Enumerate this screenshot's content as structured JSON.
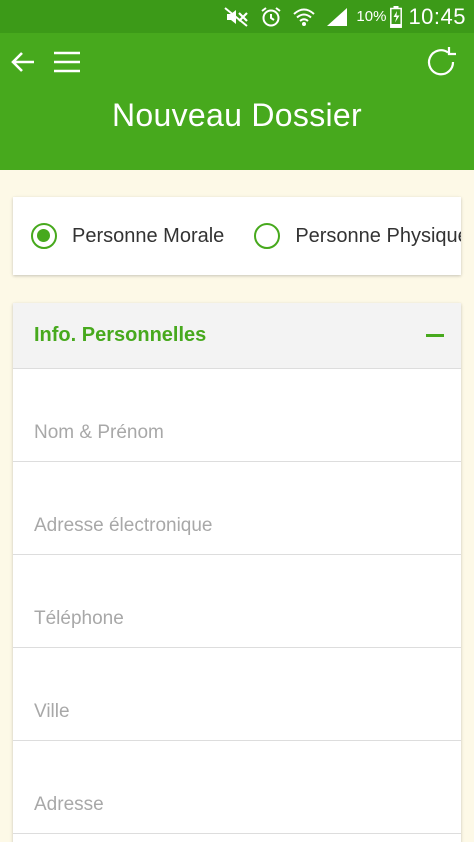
{
  "statusbar": {
    "battery_percent": "10%",
    "time": "10:45",
    "icons": [
      "mute-icon",
      "alarm-icon",
      "wifi-icon",
      "signal-icon",
      "battery-charging-icon"
    ]
  },
  "appbar": {
    "title": "Nouveau Dossier",
    "icons": [
      "back-arrow-icon",
      "hamburger-menu-icon",
      "refresh-icon"
    ],
    "color": "#47a91d"
  },
  "type_selector": {
    "options": [
      {
        "label": "Personne Morale",
        "checked": true
      },
      {
        "label": "Personne Physique",
        "checked": false
      }
    ]
  },
  "personal_info": {
    "title": "Info. Personnelles",
    "expanded": true,
    "fields": [
      {
        "placeholder": "Nom & Prénom",
        "value": ""
      },
      {
        "placeholder": "Adresse électronique",
        "value": ""
      },
      {
        "placeholder": "Téléphone",
        "value": ""
      },
      {
        "placeholder": "Ville",
        "value": ""
      },
      {
        "placeholder": "Adresse",
        "value": ""
      }
    ]
  },
  "colors": {
    "accent": "#47a91d",
    "statusbar": "#3c9a18",
    "background": "#fdf9e7"
  }
}
